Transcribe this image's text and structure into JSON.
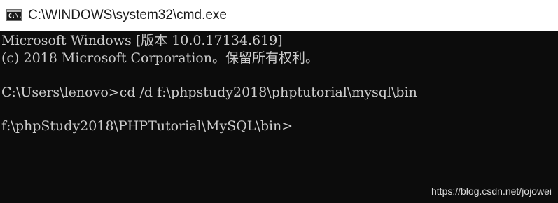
{
  "window": {
    "title": "C:\\WINDOWS\\system32\\cmd.exe",
    "icon": "cmd-icon",
    "icon_text": "C:\\."
  },
  "console": {
    "lines": [
      "Microsoft Windows [版本 10.0.17134.619]",
      "(c) 2018 Microsoft Corporation。保留所有权利。",
      "",
      "C:\\Users\\lenovo>cd /d f:\\phpstudy2018\\phptutorial\\mysql\\bin",
      "",
      "f:\\phpStudy2018\\PHPTutorial\\MySQL\\bin>"
    ]
  },
  "watermark": "https://blog.csdn.net/jojowei",
  "colors": {
    "console_bg": "#0c0c0c",
    "console_text": "#cccccc",
    "titlebar_bg": "#ffffff"
  }
}
